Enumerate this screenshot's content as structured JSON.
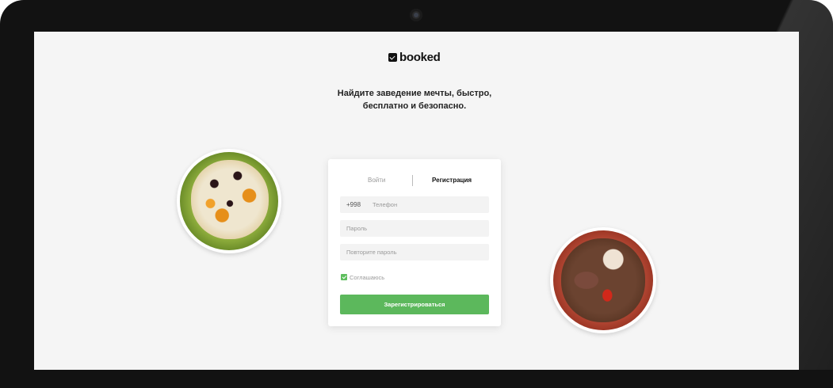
{
  "brand": {
    "name": "booked"
  },
  "headline": {
    "line1": "Найдите заведение мечты, быстро,",
    "line2": "бесплатно и безопасно."
  },
  "auth": {
    "tabs": {
      "login": "Войти",
      "register": "Регистрация",
      "active": "register"
    },
    "phone": {
      "code": "+998",
      "placeholder": "Телефон"
    },
    "password": {
      "placeholder": "Пароль"
    },
    "password_repeat": {
      "placeholder": "Повторите пароль"
    },
    "agree": {
      "label": "Соглашаюсь",
      "checked": true
    },
    "submit_label": "Зарегистрироваться"
  },
  "colors": {
    "accent": "#5cb85c",
    "background": "#f5f5f5",
    "bezel": "#121212"
  }
}
